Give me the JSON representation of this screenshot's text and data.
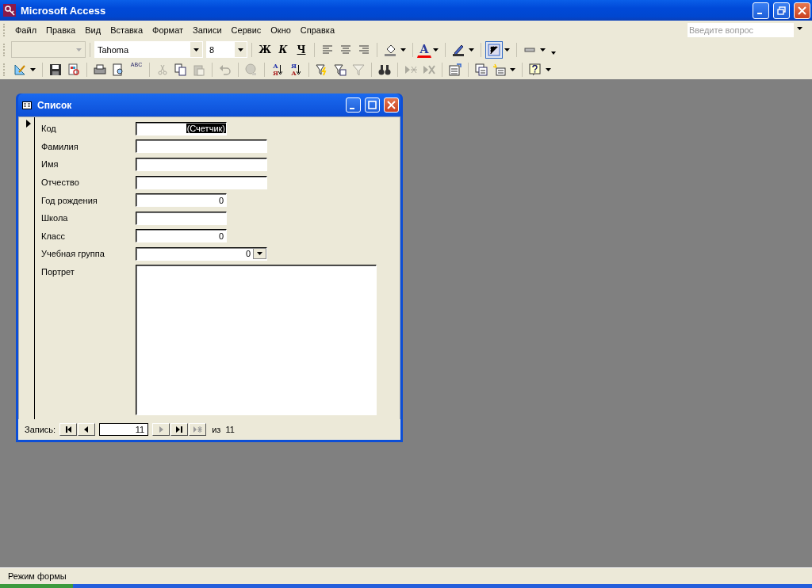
{
  "window": {
    "title": "Microsoft Access"
  },
  "menu": [
    {
      "label": "Файл"
    },
    {
      "label": "Правка"
    },
    {
      "label": "Вид"
    },
    {
      "label": "Вставка"
    },
    {
      "label": "Формат"
    },
    {
      "label": "Записи"
    },
    {
      "label": "Сервис"
    },
    {
      "label": "Окно"
    },
    {
      "label": "Справка"
    }
  ],
  "help_box": {
    "placeholder": "Введите вопрос"
  },
  "toolbar_1": [
    {
      "kind": "style_combo",
      "disabled": true
    },
    {
      "kind": "sep"
    },
    {
      "kind": "font_combo",
      "disabled": false,
      "value": "Tahoma"
    },
    {
      "kind": "size_combo",
      "disabled": false,
      "value": "8"
    },
    {
      "kind": "sep"
    },
    {
      "kind": "bold",
      "disabled": false,
      "label": "Ж"
    },
    {
      "kind": "italic",
      "disabled": false,
      "label": "К"
    },
    {
      "kind": "underline",
      "disabled": false,
      "label": "Ч"
    },
    {
      "kind": "sep"
    },
    {
      "kind": "align_left",
      "disabled": false
    },
    {
      "kind": "align_center",
      "disabled": false
    },
    {
      "kind": "align_right",
      "disabled": false
    },
    {
      "kind": "sep"
    },
    {
      "kind": "fill_color",
      "disabled": false,
      "dropdown": true
    },
    {
      "kind": "sep"
    },
    {
      "kind": "font_color",
      "disabled": false,
      "dropdown": true,
      "label": "A"
    },
    {
      "kind": "sep"
    },
    {
      "kind": "line_color",
      "disabled": false,
      "dropdown": true
    },
    {
      "kind": "sep"
    },
    {
      "kind": "border",
      "disabled": false,
      "dropdown": true,
      "selected": true
    },
    {
      "kind": "sep"
    },
    {
      "kind": "line_width",
      "disabled": false,
      "dropdown": true
    },
    {
      "kind": "more"
    }
  ],
  "toolbar_2": [
    {
      "kind": "design",
      "disabled": false,
      "dropdown": true
    },
    {
      "kind": "sep"
    },
    {
      "kind": "save",
      "disabled": false
    },
    {
      "kind": "file_search",
      "disabled": false
    },
    {
      "kind": "sep"
    },
    {
      "kind": "print",
      "disabled": false
    },
    {
      "kind": "print_preview",
      "disabled": false
    },
    {
      "kind": "spelling",
      "disabled": false,
      "label": "ABC"
    },
    {
      "kind": "sep"
    },
    {
      "kind": "cut",
      "disabled": true
    },
    {
      "kind": "copy",
      "disabled": false
    },
    {
      "kind": "paste",
      "disabled": true
    },
    {
      "kind": "sep"
    },
    {
      "kind": "undo",
      "disabled": true
    },
    {
      "kind": "sep"
    },
    {
      "kind": "hyperlink",
      "disabled": true
    },
    {
      "kind": "sep"
    },
    {
      "kind": "sort_asc",
      "disabled": false,
      "label": "А",
      "label_2": "Я"
    },
    {
      "kind": "sort_desc",
      "disabled": false,
      "label": "Я",
      "label_2": "А"
    },
    {
      "kind": "sep"
    },
    {
      "kind": "filter_selection",
      "disabled": false
    },
    {
      "kind": "filter_form",
      "disabled": false
    },
    {
      "kind": "filter_apply",
      "disabled": true
    },
    {
      "kind": "sep"
    },
    {
      "kind": "find",
      "disabled": false
    },
    {
      "kind": "sep"
    },
    {
      "kind": "new_record",
      "disabled": true
    },
    {
      "kind": "delete_record",
      "disabled": true
    },
    {
      "kind": "sep"
    },
    {
      "kind": "properties",
      "disabled": false
    },
    {
      "kind": "sep"
    },
    {
      "kind": "database_window",
      "disabled": false
    },
    {
      "kind": "new_object",
      "disabled": false,
      "dropdown": true
    },
    {
      "kind": "sep"
    },
    {
      "kind": "help",
      "disabled": false,
      "dropdown": true
    }
  ],
  "form": {
    "title": "Список",
    "fields": [
      {
        "label": "Код",
        "kind": "counter",
        "value": "(Счетчик)",
        "wide": false
      },
      {
        "label": "Фамилия",
        "kind": "text",
        "wide": true
      },
      {
        "label": "Имя",
        "kind": "text",
        "wide": true
      },
      {
        "label": "Отчество",
        "kind": "text",
        "wide": true
      },
      {
        "label": "Год рождения",
        "kind": "number",
        "value": "0",
        "wide": false
      },
      {
        "label": "Школа",
        "kind": "text",
        "wide": false
      },
      {
        "label": "Класс",
        "kind": "number",
        "value": "0",
        "wide": false
      },
      {
        "label": "Учебная группа",
        "kind": "combo",
        "value": "0",
        "wide": true
      },
      {
        "label": "Портрет",
        "kind": "picture"
      }
    ],
    "navigation": {
      "label": "Запись:",
      "current": "11",
      "of": "из",
      "total": "11",
      "buttons": [
        {
          "kind": "first",
          "disabled": false
        },
        {
          "kind": "prev",
          "disabled": false
        },
        {
          "kind": "field"
        },
        {
          "kind": "next",
          "disabled": true
        },
        {
          "kind": "last",
          "disabled": false
        },
        {
          "kind": "new",
          "disabled": true
        }
      ]
    }
  },
  "status_bar": {
    "text": "Режим формы"
  }
}
